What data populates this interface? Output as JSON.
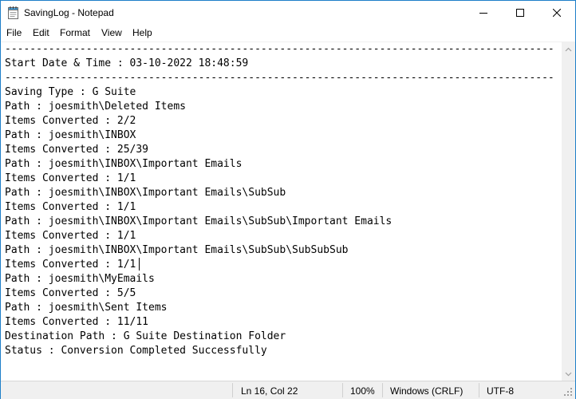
{
  "window": {
    "title": "SavingLog - Notepad",
    "controls": {
      "minimize": "minimize-icon",
      "maximize": "maximize-icon",
      "close": "close-icon"
    }
  },
  "menu": {
    "items": [
      {
        "label": "File"
      },
      {
        "label": "Edit"
      },
      {
        "label": "Format"
      },
      {
        "label": "View"
      },
      {
        "label": "Help"
      }
    ]
  },
  "editor": {
    "lines": [
      "----------------------------------------------------------------------------------------",
      "Start Date & Time : 03-10-2022 18:48:59",
      "----------------------------------------------------------------------------------------",
      "Saving Type : G Suite",
      "Path : joesmith\\Deleted Items",
      "Items Converted : 2/2",
      "Path : joesmith\\INBOX",
      "Items Converted : 25/39",
      "Path : joesmith\\INBOX\\Important Emails",
      "Items Converted : 1/1",
      "Path : joesmith\\INBOX\\Important Emails\\SubSub",
      "Items Converted : 1/1",
      "Path : joesmith\\INBOX\\Important Emails\\SubSub\\Important Emails",
      "Items Converted : 1/1",
      "Path : joesmith\\INBOX\\Important Emails\\SubSub\\SubSubSub",
      "Items Converted : 1/1",
      "Path : joesmith\\MyEmails",
      "Items Converted : 5/5",
      "Path : joesmith\\Sent Items",
      "Items Converted : 11/11",
      "Destination Path : G Suite Destination Folder",
      "Status : Conversion Completed Successfully"
    ]
  },
  "status": {
    "position": "Ln 16, Col 22",
    "zoom": "100%",
    "line_ending": "Windows (CRLF)",
    "encoding": "UTF-8"
  },
  "colors": {
    "window_border": "#1e7fc9",
    "statusbar_bg": "#f0f0f0"
  }
}
